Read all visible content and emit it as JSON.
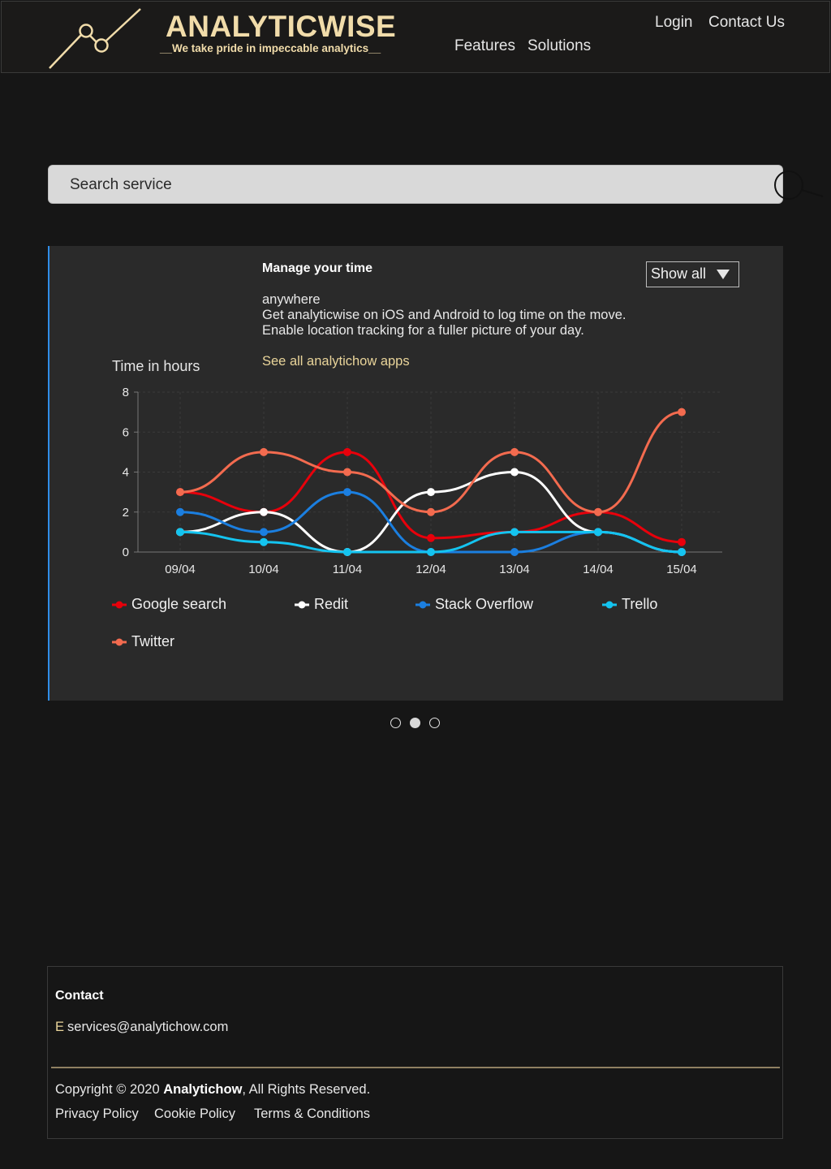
{
  "brand": {
    "title": "ANALYTICWISE",
    "tagline": "__We take pride in impeccable analytics__",
    "accent_color": "#f1dcaa"
  },
  "nav": {
    "features": "Features",
    "solutions": "Solutions",
    "login": "Login",
    "contact": "Contact Us"
  },
  "search": {
    "placeholder": "Search service",
    "icon": "magnifier-icon"
  },
  "promo": {
    "title": "Manage your time",
    "line1": "anywhere",
    "line2": "Get analyticwise on iOS and Android to log time on the move.",
    "line3": "Enable location tracking for a fuller picture of your day.",
    "link": "See all analytichow apps"
  },
  "filter": {
    "selected": "Show all"
  },
  "chart_data": {
    "type": "line",
    "title": "",
    "ylabel": "Time in hours",
    "xlabel": "",
    "categories": [
      "09/04",
      "10/04",
      "11/04",
      "12/04",
      "13/04",
      "14/04",
      "15/04"
    ],
    "ylim": [
      0,
      8
    ],
    "yticks": [
      0,
      2,
      4,
      6,
      8
    ],
    "grid": true,
    "smooth": true,
    "legend_position": "bottom",
    "series": [
      {
        "name": "Google search",
        "color": "#e8000b",
        "values": [
          3,
          2,
          5,
          0.7,
          1,
          2,
          0.5
        ]
      },
      {
        "name": "Redit",
        "color": "#ffffff",
        "values": [
          1,
          2,
          0,
          3,
          4,
          1,
          0
        ]
      },
      {
        "name": "Stack Overflow",
        "color": "#1b7fe0",
        "values": [
          2,
          1,
          3,
          0,
          0,
          1,
          0
        ]
      },
      {
        "name": "Trello",
        "color": "#14c4f0",
        "values": [
          1,
          0.5,
          0,
          0,
          1,
          1,
          0
        ]
      },
      {
        "name": "Twitter",
        "color": "#f36b4f",
        "values": [
          3,
          5,
          4,
          2,
          5,
          2,
          7
        ]
      }
    ]
  },
  "carousel": {
    "active_index": 1,
    "count": 3
  },
  "footer": {
    "heading": "Contact",
    "email_prefix": "E",
    "email": "services@analytichow.com",
    "copyright_pre": "Copyright © 2020 ",
    "copyright_brand": "Analytichow",
    "copyright_post": ", All Rights Reserved.",
    "links": [
      "Privacy Policy",
      "Cookie Policy",
      "Terms & Conditions"
    ]
  }
}
